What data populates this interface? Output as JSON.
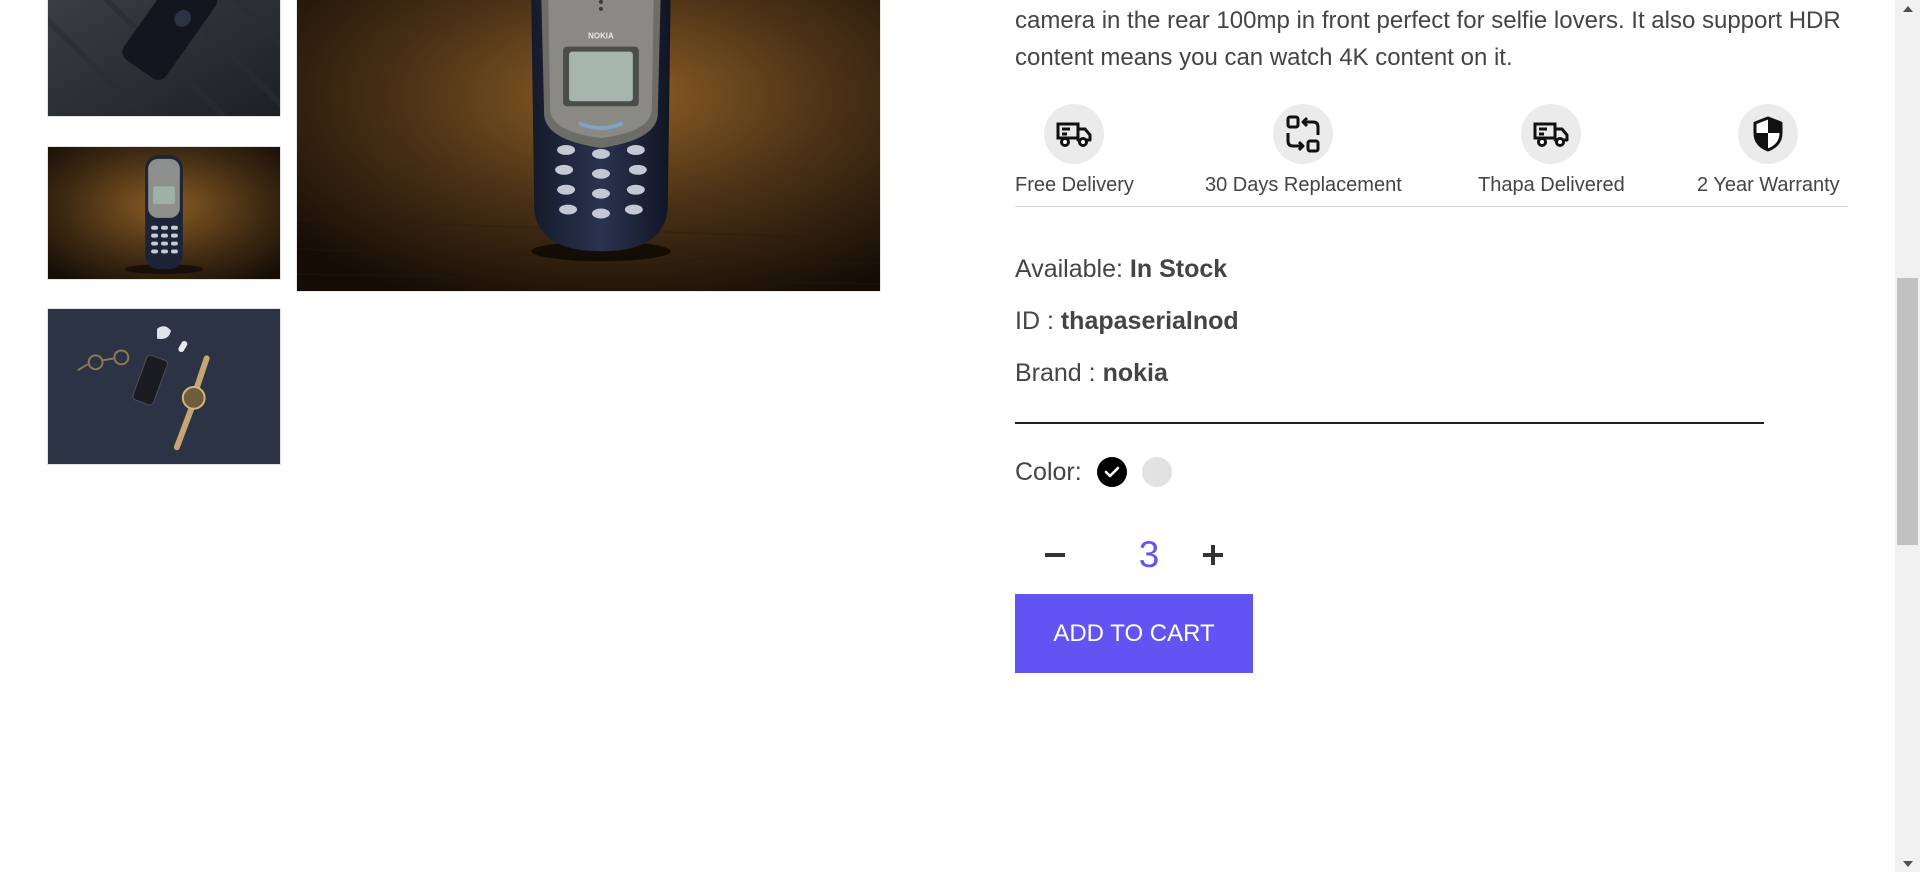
{
  "product": {
    "description": "camera in the rear 100mp in front perfect for selfie lovers. It also support HDR content means you can watch 4K content on it."
  },
  "services": [
    {
      "label": "Free Delivery",
      "icon": "truck-icon"
    },
    {
      "label": "30 Days Replacement",
      "icon": "replace-arrows-icon"
    },
    {
      "label": "Thapa Delivered",
      "icon": "truck-icon"
    },
    {
      "label": "2 Year Warranty",
      "icon": "shield-icon"
    }
  ],
  "details": {
    "available_label": "Available:",
    "available_value": "In Stock",
    "id_label": "ID :",
    "id_value": "thapaserialnod",
    "brand_label": "Brand :",
    "brand_value": "nokia"
  },
  "colors": {
    "label": "Color:",
    "options": [
      "#000000",
      "#e2e2e2"
    ],
    "selected": "#000000"
  },
  "quantity": {
    "value": "3"
  },
  "cart": {
    "button_label": "ADD TO CART",
    "accent": "#6254f3"
  }
}
